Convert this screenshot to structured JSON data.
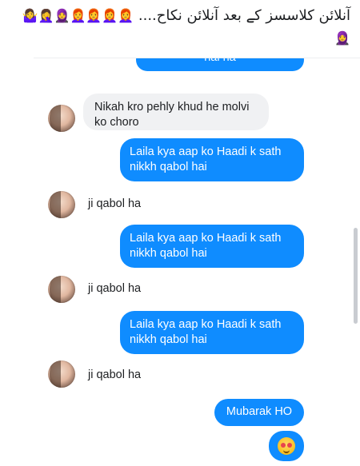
{
  "post": {
    "caption": "آنلائن کلاسسز کے بعد آنلائن نکاح....",
    "emojis": "👩‍🦰👩‍🦰👩‍🦰👩‍🦰🧕🤦‍♀️🤷‍♀️🧕"
  },
  "messages": {
    "top_partial": "hai ha",
    "m1": "Nikah kro pehly khud he molvi ko choro",
    "m2": "Laila kya aap ko Haadi k sath nikkh qabol hai",
    "m3": "ji qabol ha",
    "m4": "Laila kya aap ko Haadi k sath nikkh qabol hai",
    "m5": "ji qabol ha",
    "m6": "Laila kya aap ko Haadi k sath nikkh qabol hai",
    "m7": "ji qabol ha",
    "m8": "Mubarak HO",
    "m9_emoji": "heart-eyes-emoji"
  },
  "colors": {
    "outgoing_bubble": "#0f8cff",
    "incoming_bubble": "#f0f1f3"
  }
}
